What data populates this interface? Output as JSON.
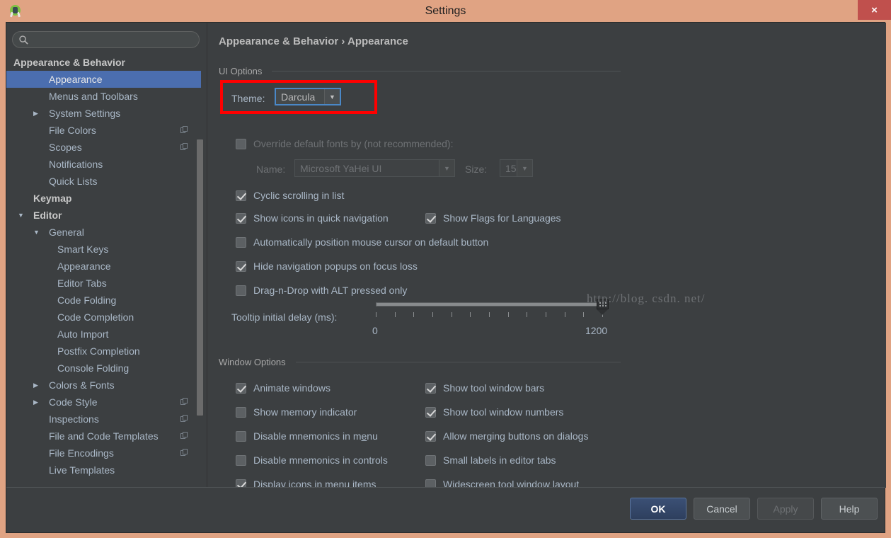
{
  "window": {
    "title": "Settings",
    "app_icon": "android-studio-icon",
    "close_label": "×",
    "titlebar_color": "#e0a383",
    "close_button_color": "#c0504d"
  },
  "sidebar": {
    "search": {
      "value": "",
      "placeholder": "",
      "icon": "search-icon"
    },
    "tree": [
      {
        "label": "Appearance & Behavior",
        "indent": 10,
        "arrow": "▼",
        "bold": true,
        "selected": false,
        "copy": false
      },
      {
        "label": "Appearance",
        "indent": 60,
        "arrow": "",
        "bold": false,
        "selected": true,
        "copy": false
      },
      {
        "label": "Menus and Toolbars",
        "indent": 60,
        "arrow": "",
        "bold": false,
        "selected": false,
        "copy": false
      },
      {
        "label": "System Settings",
        "indent": 60,
        "arrow": "▶",
        "bold": false,
        "selected": false,
        "copy": false
      },
      {
        "label": "File Colors",
        "indent": 60,
        "arrow": "",
        "bold": false,
        "selected": false,
        "copy": true
      },
      {
        "label": "Scopes",
        "indent": 60,
        "arrow": "",
        "bold": false,
        "selected": false,
        "copy": true
      },
      {
        "label": "Notifications",
        "indent": 60,
        "arrow": "",
        "bold": false,
        "selected": false,
        "copy": false
      },
      {
        "label": "Quick Lists",
        "indent": 60,
        "arrow": "",
        "bold": false,
        "selected": false,
        "copy": false
      },
      {
        "label": "Keymap",
        "indent": 38,
        "arrow": "",
        "bold": true,
        "selected": false,
        "copy": false
      },
      {
        "label": "Editor",
        "indent": 38,
        "arrow": "▼",
        "bold": true,
        "selected": false,
        "copy": false
      },
      {
        "label": "General",
        "indent": 60,
        "arrow": "▼",
        "bold": false,
        "selected": false,
        "copy": false
      },
      {
        "label": "Smart Keys",
        "indent": 72,
        "arrow": "",
        "bold": false,
        "selected": false,
        "copy": false
      },
      {
        "label": "Appearance",
        "indent": 72,
        "arrow": "",
        "bold": false,
        "selected": false,
        "copy": false
      },
      {
        "label": "Editor Tabs",
        "indent": 72,
        "arrow": "",
        "bold": false,
        "selected": false,
        "copy": false
      },
      {
        "label": "Code Folding",
        "indent": 72,
        "arrow": "",
        "bold": false,
        "selected": false,
        "copy": false
      },
      {
        "label": "Code Completion",
        "indent": 72,
        "arrow": "",
        "bold": false,
        "selected": false,
        "copy": false
      },
      {
        "label": "Auto Import",
        "indent": 72,
        "arrow": "",
        "bold": false,
        "selected": false,
        "copy": false
      },
      {
        "label": "Postfix Completion",
        "indent": 72,
        "arrow": "",
        "bold": false,
        "selected": false,
        "copy": false
      },
      {
        "label": "Console Folding",
        "indent": 72,
        "arrow": "",
        "bold": false,
        "selected": false,
        "copy": false
      },
      {
        "label": "Colors & Fonts",
        "indent": 60,
        "arrow": "▶",
        "bold": false,
        "selected": false,
        "copy": false
      },
      {
        "label": "Code Style",
        "indent": 60,
        "arrow": "▶",
        "bold": false,
        "selected": false,
        "copy": true
      },
      {
        "label": "Inspections",
        "indent": 60,
        "arrow": "",
        "bold": false,
        "selected": false,
        "copy": true
      },
      {
        "label": "File and Code Templates",
        "indent": 60,
        "arrow": "",
        "bold": false,
        "selected": false,
        "copy": true
      },
      {
        "label": "File Encodings",
        "indent": 60,
        "arrow": "",
        "bold": false,
        "selected": false,
        "copy": true
      },
      {
        "label": "Live Templates",
        "indent": 60,
        "arrow": "",
        "bold": false,
        "selected": false,
        "copy": false
      }
    ]
  },
  "content": {
    "breadcrumb": "Appearance & Behavior › Appearance",
    "ui_options": {
      "group_title": "UI Options",
      "theme_label": "Theme:",
      "theme_value": "Darcula",
      "theme_focused": true,
      "override_fonts_label": "Override default fonts by (not recommended):",
      "override_fonts_checked": false,
      "name_label": "Name:",
      "name_value": "Microsoft YaHei UI",
      "size_label": "Size:",
      "size_value": "15",
      "checkboxes": [
        {
          "label": "Cyclic scrolling in list",
          "checked": true,
          "col": 0,
          "row": 0
        },
        {
          "label": "Show icons in quick navigation",
          "checked": true,
          "col": 0,
          "row": 1
        },
        {
          "label": "Show Flags for Languages",
          "checked": true,
          "col": 1,
          "row": 1
        },
        {
          "label": "Automatically position mouse cursor on default button",
          "checked": false,
          "col": 0,
          "row": 2
        },
        {
          "label": "Hide navigation popups on focus loss",
          "checked": true,
          "col": 0,
          "row": 3
        },
        {
          "label": "Drag-n-Drop with ALT pressed only",
          "checked": false,
          "col": 0,
          "row": 4
        }
      ],
      "tooltip_label": "Tooltip initial delay (ms):",
      "tooltip_min": "0",
      "tooltip_max": "1200",
      "tooltip_value": 1200
    },
    "window_options": {
      "group_title": "Window Options",
      "left_column": [
        {
          "label": "Animate windows",
          "checked": true
        },
        {
          "label": "Show memory indicator",
          "checked": false
        },
        {
          "label": "Disable mnemonics in menu",
          "checked": false,
          "underline_index": 22
        },
        {
          "label": "Disable mnemonics in controls",
          "checked": false
        },
        {
          "label": "Display icons in menu items",
          "checked": true
        }
      ],
      "right_column": [
        {
          "label": "Show tool window bars",
          "checked": true
        },
        {
          "label": "Show tool window numbers",
          "checked": true
        },
        {
          "label": "Allow merging buttons on dialogs",
          "checked": true
        },
        {
          "label": "Small labels in editor tabs",
          "checked": false
        },
        {
          "label": "Widescreen tool window layout",
          "checked": false
        }
      ]
    },
    "watermark": "http://blog. csdn. net/"
  },
  "footer": {
    "buttons": [
      {
        "label": "OK",
        "style": "default"
      },
      {
        "label": "Cancel",
        "style": "normal"
      },
      {
        "label": "Apply",
        "style": "disabled"
      },
      {
        "label": "Help",
        "style": "normal"
      }
    ]
  },
  "annotation": {
    "redbox_color": "#ff0000",
    "target": "theme-dropdown"
  }
}
